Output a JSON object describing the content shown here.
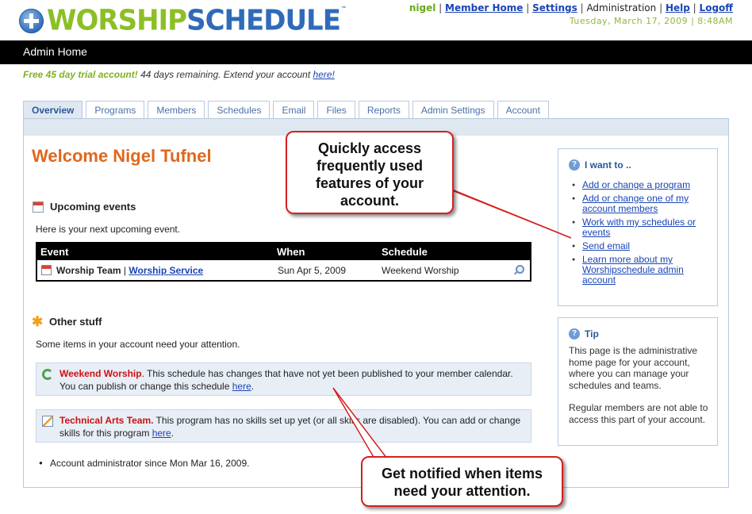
{
  "brand": {
    "part1": "WORSHIP",
    "part2": "SCHEDULE",
    "tm": "™",
    "icon": "cross-circle-icon"
  },
  "topnav": {
    "user": "nigel",
    "items": [
      "Member Home",
      "Settings",
      "Administration",
      "Help",
      "Logoff"
    ],
    "separator": "|",
    "date": "Tuesday, March 17, 2009 | 8:48AM"
  },
  "page_title": "Admin Home",
  "trial": {
    "highlight": "Free 45 day trial account!",
    "text": " 44 days remaining. Extend your account ",
    "link": "here!"
  },
  "tabs": [
    "Overview",
    "Programs",
    "Members",
    "Schedules",
    "Email",
    "Files",
    "Reports",
    "Admin Settings",
    "Account"
  ],
  "active_tab": "Overview",
  "welcome": "Welcome Nigel Tufnel",
  "upcoming": {
    "heading": "Upcoming events",
    "intro": "Here is your next upcoming event.",
    "columns": [
      "Event",
      "When",
      "Schedule"
    ],
    "row": {
      "team": "Worship Team",
      "sep": " | ",
      "service": "Worship Service",
      "when": "Sun Apr 5, 2009",
      "schedule": "Weekend Worship"
    }
  },
  "other": {
    "heading": "Other stuff",
    "intro": "Some items in your account need your attention.",
    "notice1": {
      "title": "Weekend Worship",
      "text": ". This schedule has changes that have not yet been published to your member calendar. You can publish or change this schedule ",
      "link": "here",
      "end": "."
    },
    "notice2": {
      "title": "Technical Arts Team.",
      "text": " This program has no skills set up yet (or all skills are disabled). You can add or change skills for this program ",
      "link": "here",
      "end": "."
    },
    "admin_since": "Account administrator since Mon Mar 16, 2009."
  },
  "i_want_to": {
    "heading": "I want to ..",
    "links": [
      "Add or change a program",
      "Add or change one of my account members",
      "Work with my schedules or events",
      "Send email",
      "Learn more about my Worshipschedule admin account"
    ]
  },
  "tip": {
    "heading": "Tip",
    "p1": "This page is the administrative home page for your account, where you can manage your schedules and teams.",
    "p2": "Regular members are not able to access this part of your account."
  },
  "callouts": {
    "top": "Quickly access frequently used features of your account.",
    "bottom": "Get notified when items need your attention."
  },
  "colors": {
    "brand_green": "#8cbf26",
    "brand_blue": "#2f6bb8",
    "welcome_orange": "#e0671c",
    "alert_red": "#cc1111",
    "callout_border": "#d42020"
  }
}
